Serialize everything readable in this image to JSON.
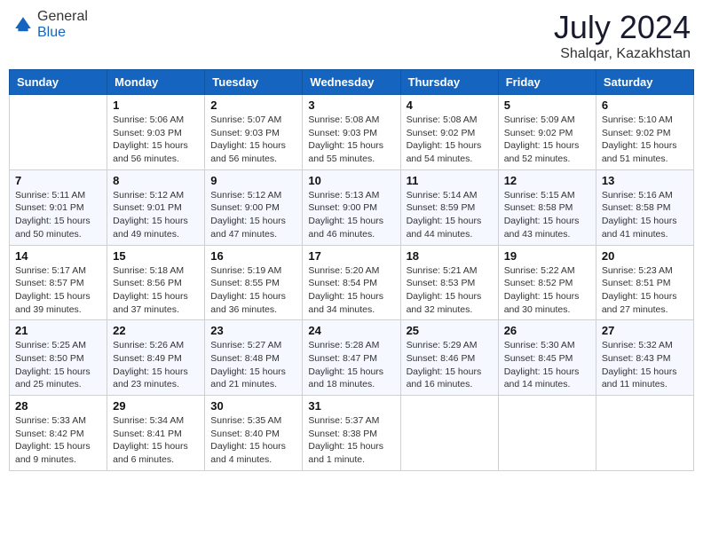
{
  "header": {
    "logo_general": "General",
    "logo_blue": "Blue",
    "month_year": "July 2024",
    "location": "Shalqar, Kazakhstan"
  },
  "days_of_week": [
    "Sunday",
    "Monday",
    "Tuesday",
    "Wednesday",
    "Thursday",
    "Friday",
    "Saturday"
  ],
  "weeks": [
    [
      {
        "day": "",
        "sunrise": "",
        "sunset": "",
        "daylight": ""
      },
      {
        "day": "1",
        "sunrise": "Sunrise: 5:06 AM",
        "sunset": "Sunset: 9:03 PM",
        "daylight": "Daylight: 15 hours and 56 minutes."
      },
      {
        "day": "2",
        "sunrise": "Sunrise: 5:07 AM",
        "sunset": "Sunset: 9:03 PM",
        "daylight": "Daylight: 15 hours and 56 minutes."
      },
      {
        "day": "3",
        "sunrise": "Sunrise: 5:08 AM",
        "sunset": "Sunset: 9:03 PM",
        "daylight": "Daylight: 15 hours and 55 minutes."
      },
      {
        "day": "4",
        "sunrise": "Sunrise: 5:08 AM",
        "sunset": "Sunset: 9:02 PM",
        "daylight": "Daylight: 15 hours and 54 minutes."
      },
      {
        "day": "5",
        "sunrise": "Sunrise: 5:09 AM",
        "sunset": "Sunset: 9:02 PM",
        "daylight": "Daylight: 15 hours and 52 minutes."
      },
      {
        "day": "6",
        "sunrise": "Sunrise: 5:10 AM",
        "sunset": "Sunset: 9:02 PM",
        "daylight": "Daylight: 15 hours and 51 minutes."
      }
    ],
    [
      {
        "day": "7",
        "sunrise": "Sunrise: 5:11 AM",
        "sunset": "Sunset: 9:01 PM",
        "daylight": "Daylight: 15 hours and 50 minutes."
      },
      {
        "day": "8",
        "sunrise": "Sunrise: 5:12 AM",
        "sunset": "Sunset: 9:01 PM",
        "daylight": "Daylight: 15 hours and 49 minutes."
      },
      {
        "day": "9",
        "sunrise": "Sunrise: 5:12 AM",
        "sunset": "Sunset: 9:00 PM",
        "daylight": "Daylight: 15 hours and 47 minutes."
      },
      {
        "day": "10",
        "sunrise": "Sunrise: 5:13 AM",
        "sunset": "Sunset: 9:00 PM",
        "daylight": "Daylight: 15 hours and 46 minutes."
      },
      {
        "day": "11",
        "sunrise": "Sunrise: 5:14 AM",
        "sunset": "Sunset: 8:59 PM",
        "daylight": "Daylight: 15 hours and 44 minutes."
      },
      {
        "day": "12",
        "sunrise": "Sunrise: 5:15 AM",
        "sunset": "Sunset: 8:58 PM",
        "daylight": "Daylight: 15 hours and 43 minutes."
      },
      {
        "day": "13",
        "sunrise": "Sunrise: 5:16 AM",
        "sunset": "Sunset: 8:58 PM",
        "daylight": "Daylight: 15 hours and 41 minutes."
      }
    ],
    [
      {
        "day": "14",
        "sunrise": "Sunrise: 5:17 AM",
        "sunset": "Sunset: 8:57 PM",
        "daylight": "Daylight: 15 hours and 39 minutes."
      },
      {
        "day": "15",
        "sunrise": "Sunrise: 5:18 AM",
        "sunset": "Sunset: 8:56 PM",
        "daylight": "Daylight: 15 hours and 37 minutes."
      },
      {
        "day": "16",
        "sunrise": "Sunrise: 5:19 AM",
        "sunset": "Sunset: 8:55 PM",
        "daylight": "Daylight: 15 hours and 36 minutes."
      },
      {
        "day": "17",
        "sunrise": "Sunrise: 5:20 AM",
        "sunset": "Sunset: 8:54 PM",
        "daylight": "Daylight: 15 hours and 34 minutes."
      },
      {
        "day": "18",
        "sunrise": "Sunrise: 5:21 AM",
        "sunset": "Sunset: 8:53 PM",
        "daylight": "Daylight: 15 hours and 32 minutes."
      },
      {
        "day": "19",
        "sunrise": "Sunrise: 5:22 AM",
        "sunset": "Sunset: 8:52 PM",
        "daylight": "Daylight: 15 hours and 30 minutes."
      },
      {
        "day": "20",
        "sunrise": "Sunrise: 5:23 AM",
        "sunset": "Sunset: 8:51 PM",
        "daylight": "Daylight: 15 hours and 27 minutes."
      }
    ],
    [
      {
        "day": "21",
        "sunrise": "Sunrise: 5:25 AM",
        "sunset": "Sunset: 8:50 PM",
        "daylight": "Daylight: 15 hours and 25 minutes."
      },
      {
        "day": "22",
        "sunrise": "Sunrise: 5:26 AM",
        "sunset": "Sunset: 8:49 PM",
        "daylight": "Daylight: 15 hours and 23 minutes."
      },
      {
        "day": "23",
        "sunrise": "Sunrise: 5:27 AM",
        "sunset": "Sunset: 8:48 PM",
        "daylight": "Daylight: 15 hours and 21 minutes."
      },
      {
        "day": "24",
        "sunrise": "Sunrise: 5:28 AM",
        "sunset": "Sunset: 8:47 PM",
        "daylight": "Daylight: 15 hours and 18 minutes."
      },
      {
        "day": "25",
        "sunrise": "Sunrise: 5:29 AM",
        "sunset": "Sunset: 8:46 PM",
        "daylight": "Daylight: 15 hours and 16 minutes."
      },
      {
        "day": "26",
        "sunrise": "Sunrise: 5:30 AM",
        "sunset": "Sunset: 8:45 PM",
        "daylight": "Daylight: 15 hours and 14 minutes."
      },
      {
        "day": "27",
        "sunrise": "Sunrise: 5:32 AM",
        "sunset": "Sunset: 8:43 PM",
        "daylight": "Daylight: 15 hours and 11 minutes."
      }
    ],
    [
      {
        "day": "28",
        "sunrise": "Sunrise: 5:33 AM",
        "sunset": "Sunset: 8:42 PM",
        "daylight": "Daylight: 15 hours and 9 minutes."
      },
      {
        "day": "29",
        "sunrise": "Sunrise: 5:34 AM",
        "sunset": "Sunset: 8:41 PM",
        "daylight": "Daylight: 15 hours and 6 minutes."
      },
      {
        "day": "30",
        "sunrise": "Sunrise: 5:35 AM",
        "sunset": "Sunset: 8:40 PM",
        "daylight": "Daylight: 15 hours and 4 minutes."
      },
      {
        "day": "31",
        "sunrise": "Sunrise: 5:37 AM",
        "sunset": "Sunset: 8:38 PM",
        "daylight": "Daylight: 15 hours and 1 minute."
      },
      {
        "day": "",
        "sunrise": "",
        "sunset": "",
        "daylight": ""
      },
      {
        "day": "",
        "sunrise": "",
        "sunset": "",
        "daylight": ""
      },
      {
        "day": "",
        "sunrise": "",
        "sunset": "",
        "daylight": ""
      }
    ]
  ]
}
